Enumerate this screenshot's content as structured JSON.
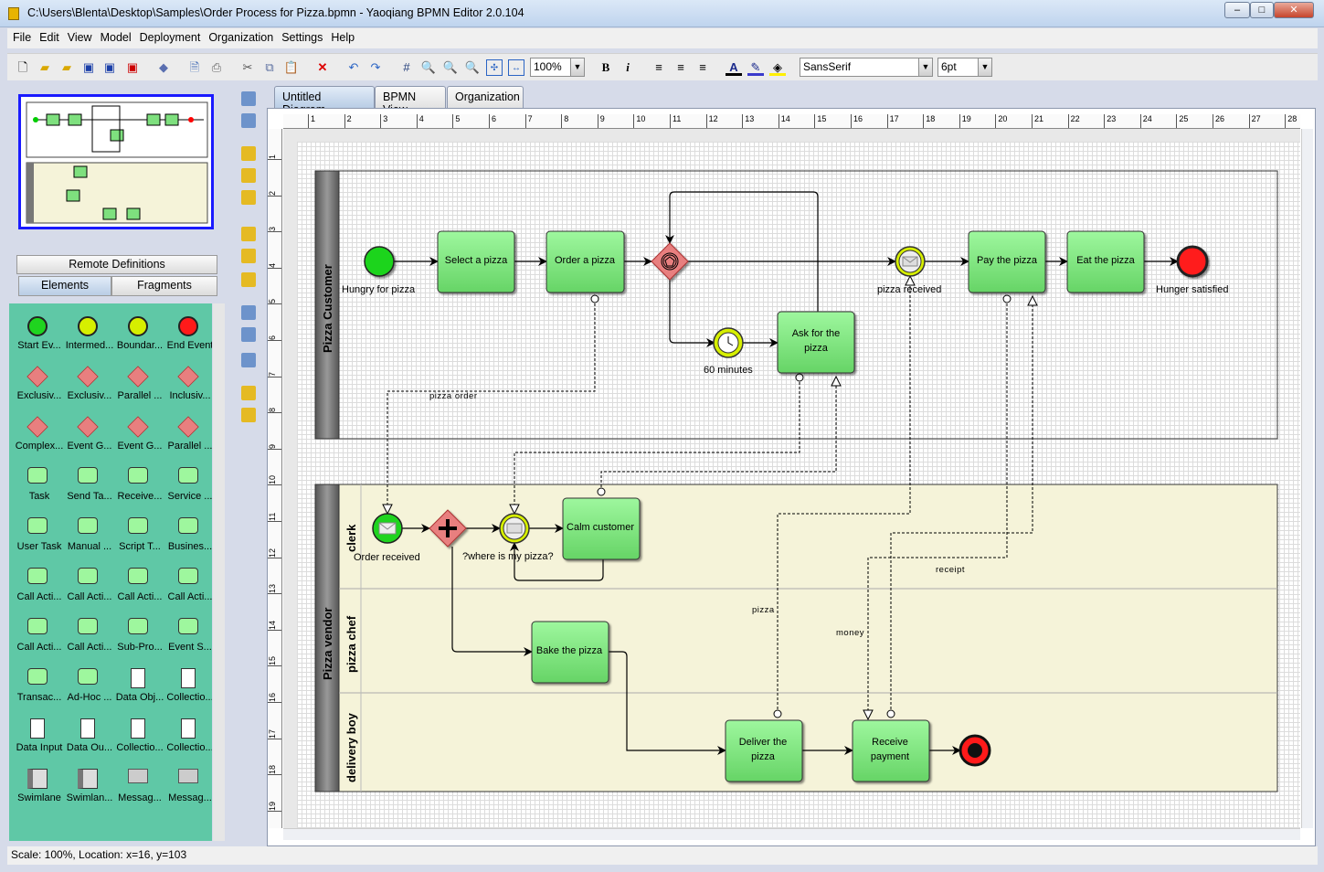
{
  "window": {
    "title": "C:\\Users\\Blenta\\Desktop\\Samples\\Order Process for Pizza.bpmn - Yaoqiang BPMN Editor 2.0.104"
  },
  "menu": [
    "File",
    "Edit",
    "View",
    "Model",
    "Deployment",
    "Organization",
    "Settings",
    "Help"
  ],
  "toolbar": {
    "zoom": "100%",
    "font": "SansSerif",
    "font_size": "6pt",
    "bold": "B",
    "italic": "i"
  },
  "left_panel": {
    "remote_definitions": "Remote Definitions",
    "tabs": [
      "Elements",
      "Fragments"
    ],
    "active_tab": "Elements",
    "palette": [
      "Start Ev...",
      "Intermed...",
      "Boundar...",
      "End Event",
      "Exclusiv...",
      "Exclusiv...",
      "Parallel ...",
      "Inclusiv...",
      "Complex...",
      "Event G...",
      "Event G...",
      "Parallel ...",
      "Task",
      "Send Ta...",
      "Receive...",
      "Service ...",
      "User Task",
      "Manual ...",
      "Script T...",
      "Busines...",
      "Call Acti...",
      "Call Acti...",
      "Call Acti...",
      "Call Acti...",
      "Call Acti...",
      "Call Acti...",
      "Sub-Pro...",
      "Event S...",
      "Transac...",
      "Ad-Hoc ...",
      "Data Obj...",
      "Collectio...",
      "Data Input",
      "Data Ou...",
      "Collectio...",
      "Collectio...",
      "Swimlane",
      "Swimlan...",
      "Messag...",
      "Messag..."
    ]
  },
  "doc_tabs": [
    "Untitled Diagram",
    "BPMN View",
    "Organization"
  ],
  "active_doc_tab": "Untitled Diagram",
  "ruler": {
    "h": [
      "1",
      "2",
      "3",
      "4",
      "5",
      "6",
      "7",
      "8",
      "9",
      "10",
      "11",
      "12",
      "13",
      "14",
      "15",
      "16",
      "17",
      "18",
      "19",
      "20",
      "21",
      "22",
      "23",
      "24",
      "25",
      "26",
      "27",
      "28"
    ],
    "v": [
      "1",
      "2",
      "3",
      "4",
      "5",
      "6",
      "7",
      "8",
      "9",
      "10",
      "11",
      "12",
      "13",
      "14",
      "15",
      "16",
      "17",
      "18",
      "19"
    ]
  },
  "diagram": {
    "pools": {
      "customer": "Pizza Customer",
      "vendor": "Pizza vendor"
    },
    "lanes": {
      "clerk": "clerk",
      "chef": "pizza chef",
      "delivery": "delivery boy"
    },
    "events": {
      "hungry": "Hungry for pizza",
      "received": "pizza received",
      "satisfied": "Hunger satisfied",
      "timer": "60 minutes",
      "order_received": "Order received",
      "where": "?where is my pizza?"
    },
    "tasks": {
      "select": "Select a pizza",
      "order": "Order a pizza",
      "ask1": "Ask for the",
      "ask2": "pizza",
      "pay": "Pay the pizza",
      "eat": "Eat the pizza",
      "calm": "Calm customer",
      "bake": "Bake the pizza",
      "deliver1": "Deliver the",
      "deliver2": "pizza",
      "receive1": "Receive",
      "receive2": "payment"
    },
    "messages": {
      "order": "pizza order",
      "pizza": "pizza",
      "money": "money",
      "receipt": "receipt"
    },
    "colors": {
      "task": "#7ee07e",
      "start": "#1fd41f",
      "end": "#ff1a1a",
      "gateway": "#e87f7f",
      "intermediate": "#d6ef00",
      "vendor_pool": "#f5f3d9"
    }
  },
  "status": "Scale: 100%, Location: x=16, y=103"
}
